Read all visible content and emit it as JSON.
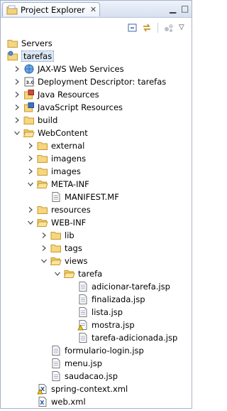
{
  "view": {
    "title": "Project Explorer",
    "close_glyph": "✕",
    "minimize_glyph": "▁",
    "maximize_glyph": "□"
  },
  "toolbar": {
    "menu_glyph": "▽"
  },
  "tree": [
    {
      "label": "Servers",
      "depth": 0,
      "toggle": "none",
      "icon": "folder-icon"
    },
    {
      "label": "tarefas",
      "depth": 0,
      "toggle": "expanded",
      "icon": "web-project-icon",
      "selected": true
    },
    {
      "label": "JAX-WS Web Services",
      "depth": 1,
      "toggle": "collapsed",
      "icon": "web-services-icon"
    },
    {
      "label": "Deployment Descriptor: tarefas",
      "depth": 1,
      "toggle": "collapsed",
      "icon": "deployment-descriptor-icon"
    },
    {
      "label": "Java Resources",
      "depth": 1,
      "toggle": "collapsed",
      "icon": "java-resources-icon"
    },
    {
      "label": "JavaScript Resources",
      "depth": 1,
      "toggle": "collapsed",
      "icon": "javascript-resources-icon"
    },
    {
      "label": "build",
      "depth": 1,
      "toggle": "collapsed",
      "icon": "folder-icon"
    },
    {
      "label": "WebContent",
      "depth": 1,
      "toggle": "expanded",
      "icon": "open-folder-icon"
    },
    {
      "label": "external",
      "depth": 2,
      "toggle": "collapsed",
      "icon": "folder-icon"
    },
    {
      "label": "imagens",
      "depth": 2,
      "toggle": "collapsed",
      "icon": "folder-icon"
    },
    {
      "label": "images",
      "depth": 2,
      "toggle": "collapsed",
      "icon": "folder-icon"
    },
    {
      "label": "META-INF",
      "depth": 2,
      "toggle": "expanded",
      "icon": "open-folder-icon"
    },
    {
      "label": "MANIFEST.MF",
      "depth": 3,
      "toggle": "none",
      "icon": "text-file-icon"
    },
    {
      "label": "resources",
      "depth": 2,
      "toggle": "collapsed",
      "icon": "folder-icon"
    },
    {
      "label": "WEB-INF",
      "depth": 2,
      "toggle": "expanded",
      "icon": "open-folder-icon"
    },
    {
      "label": "lib",
      "depth": 3,
      "toggle": "collapsed",
      "icon": "folder-icon"
    },
    {
      "label": "tags",
      "depth": 3,
      "toggle": "collapsed",
      "icon": "folder-icon"
    },
    {
      "label": "views",
      "depth": 3,
      "toggle": "expanded",
      "icon": "open-folder-icon"
    },
    {
      "label": "tarefa",
      "depth": 4,
      "toggle": "expanded",
      "icon": "open-folder-icon"
    },
    {
      "label": "adicionar-tarefa.jsp",
      "depth": 5,
      "toggle": "none",
      "icon": "jsp-file-icon"
    },
    {
      "label": "finalizada.jsp",
      "depth": 5,
      "toggle": "none",
      "icon": "jsp-file-icon"
    },
    {
      "label": "lista.jsp",
      "depth": 5,
      "toggle": "none",
      "icon": "jsp-file-icon"
    },
    {
      "label": "mostra.jsp",
      "depth": 5,
      "toggle": "none",
      "icon": "jsp-file-warning-icon"
    },
    {
      "label": "tarefa-adicionada.jsp",
      "depth": 5,
      "toggle": "none",
      "icon": "jsp-file-icon"
    },
    {
      "label": "formulario-login.jsp",
      "depth": 3,
      "toggle": "none",
      "icon": "jsp-file-icon"
    },
    {
      "label": "menu.jsp",
      "depth": 3,
      "toggle": "none",
      "icon": "jsp-file-icon"
    },
    {
      "label": "saudacao.jsp",
      "depth": 3,
      "toggle": "none",
      "icon": "jsp-file-icon"
    },
    {
      "label": "spring-context.xml",
      "depth": 2,
      "toggle": "none",
      "icon": "xml-file-warning-icon"
    },
    {
      "label": "web.xml",
      "depth": 2,
      "toggle": "none",
      "icon": "xml-file-icon"
    }
  ]
}
